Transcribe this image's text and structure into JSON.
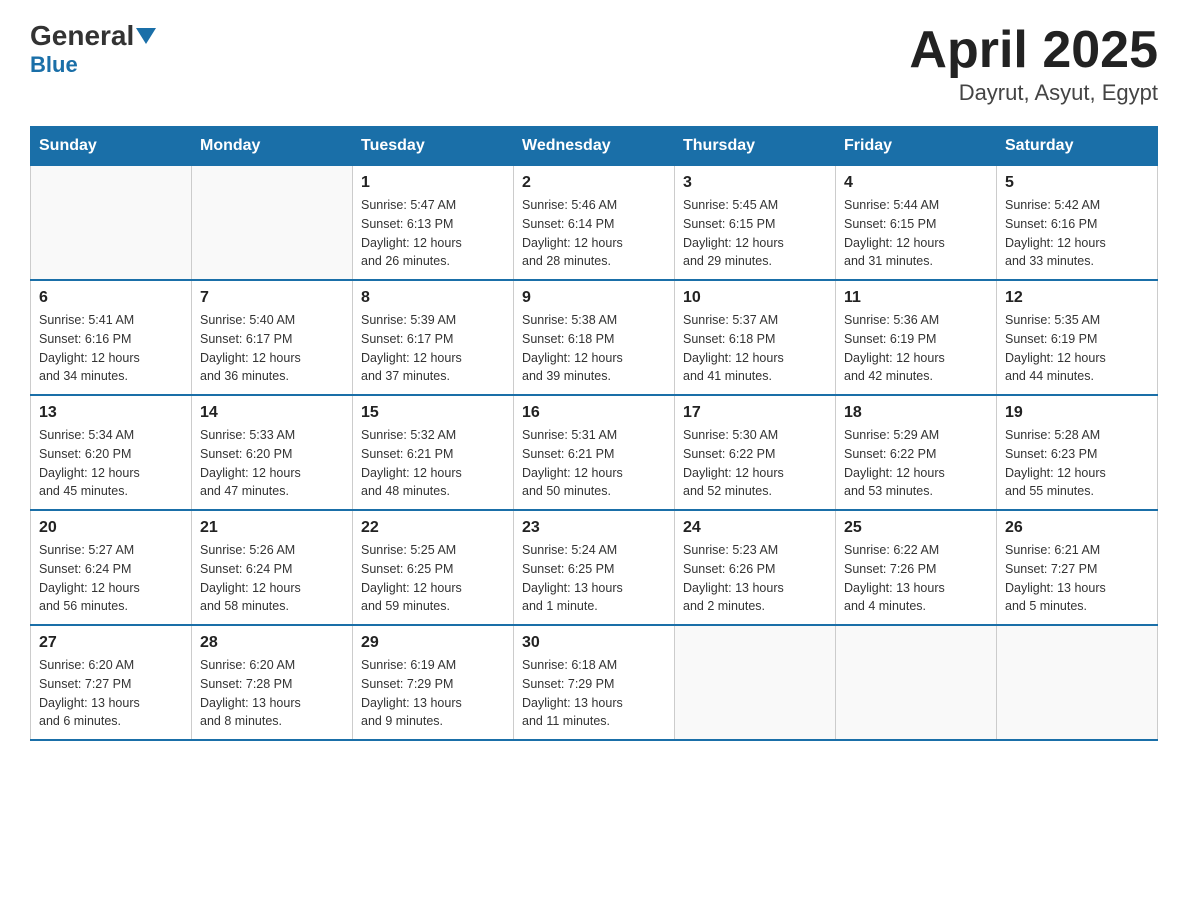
{
  "header": {
    "logo_main": "General",
    "logo_sub": "Blue",
    "title": "April 2025",
    "subtitle": "Dayrut, Asyut, Egypt"
  },
  "days_of_week": [
    "Sunday",
    "Monday",
    "Tuesday",
    "Wednesday",
    "Thursday",
    "Friday",
    "Saturday"
  ],
  "weeks": [
    [
      {
        "day": "",
        "info": ""
      },
      {
        "day": "",
        "info": ""
      },
      {
        "day": "1",
        "info": "Sunrise: 5:47 AM\nSunset: 6:13 PM\nDaylight: 12 hours\nand 26 minutes."
      },
      {
        "day": "2",
        "info": "Sunrise: 5:46 AM\nSunset: 6:14 PM\nDaylight: 12 hours\nand 28 minutes."
      },
      {
        "day": "3",
        "info": "Sunrise: 5:45 AM\nSunset: 6:15 PM\nDaylight: 12 hours\nand 29 minutes."
      },
      {
        "day": "4",
        "info": "Sunrise: 5:44 AM\nSunset: 6:15 PM\nDaylight: 12 hours\nand 31 minutes."
      },
      {
        "day": "5",
        "info": "Sunrise: 5:42 AM\nSunset: 6:16 PM\nDaylight: 12 hours\nand 33 minutes."
      }
    ],
    [
      {
        "day": "6",
        "info": "Sunrise: 5:41 AM\nSunset: 6:16 PM\nDaylight: 12 hours\nand 34 minutes."
      },
      {
        "day": "7",
        "info": "Sunrise: 5:40 AM\nSunset: 6:17 PM\nDaylight: 12 hours\nand 36 minutes."
      },
      {
        "day": "8",
        "info": "Sunrise: 5:39 AM\nSunset: 6:17 PM\nDaylight: 12 hours\nand 37 minutes."
      },
      {
        "day": "9",
        "info": "Sunrise: 5:38 AM\nSunset: 6:18 PM\nDaylight: 12 hours\nand 39 minutes."
      },
      {
        "day": "10",
        "info": "Sunrise: 5:37 AM\nSunset: 6:18 PM\nDaylight: 12 hours\nand 41 minutes."
      },
      {
        "day": "11",
        "info": "Sunrise: 5:36 AM\nSunset: 6:19 PM\nDaylight: 12 hours\nand 42 minutes."
      },
      {
        "day": "12",
        "info": "Sunrise: 5:35 AM\nSunset: 6:19 PM\nDaylight: 12 hours\nand 44 minutes."
      }
    ],
    [
      {
        "day": "13",
        "info": "Sunrise: 5:34 AM\nSunset: 6:20 PM\nDaylight: 12 hours\nand 45 minutes."
      },
      {
        "day": "14",
        "info": "Sunrise: 5:33 AM\nSunset: 6:20 PM\nDaylight: 12 hours\nand 47 minutes."
      },
      {
        "day": "15",
        "info": "Sunrise: 5:32 AM\nSunset: 6:21 PM\nDaylight: 12 hours\nand 48 minutes."
      },
      {
        "day": "16",
        "info": "Sunrise: 5:31 AM\nSunset: 6:21 PM\nDaylight: 12 hours\nand 50 minutes."
      },
      {
        "day": "17",
        "info": "Sunrise: 5:30 AM\nSunset: 6:22 PM\nDaylight: 12 hours\nand 52 minutes."
      },
      {
        "day": "18",
        "info": "Sunrise: 5:29 AM\nSunset: 6:22 PM\nDaylight: 12 hours\nand 53 minutes."
      },
      {
        "day": "19",
        "info": "Sunrise: 5:28 AM\nSunset: 6:23 PM\nDaylight: 12 hours\nand 55 minutes."
      }
    ],
    [
      {
        "day": "20",
        "info": "Sunrise: 5:27 AM\nSunset: 6:24 PM\nDaylight: 12 hours\nand 56 minutes."
      },
      {
        "day": "21",
        "info": "Sunrise: 5:26 AM\nSunset: 6:24 PM\nDaylight: 12 hours\nand 58 minutes."
      },
      {
        "day": "22",
        "info": "Sunrise: 5:25 AM\nSunset: 6:25 PM\nDaylight: 12 hours\nand 59 minutes."
      },
      {
        "day": "23",
        "info": "Sunrise: 5:24 AM\nSunset: 6:25 PM\nDaylight: 13 hours\nand 1 minute."
      },
      {
        "day": "24",
        "info": "Sunrise: 5:23 AM\nSunset: 6:26 PM\nDaylight: 13 hours\nand 2 minutes."
      },
      {
        "day": "25",
        "info": "Sunrise: 6:22 AM\nSunset: 7:26 PM\nDaylight: 13 hours\nand 4 minutes."
      },
      {
        "day": "26",
        "info": "Sunrise: 6:21 AM\nSunset: 7:27 PM\nDaylight: 13 hours\nand 5 minutes."
      }
    ],
    [
      {
        "day": "27",
        "info": "Sunrise: 6:20 AM\nSunset: 7:27 PM\nDaylight: 13 hours\nand 6 minutes."
      },
      {
        "day": "28",
        "info": "Sunrise: 6:20 AM\nSunset: 7:28 PM\nDaylight: 13 hours\nand 8 minutes."
      },
      {
        "day": "29",
        "info": "Sunrise: 6:19 AM\nSunset: 7:29 PM\nDaylight: 13 hours\nand 9 minutes."
      },
      {
        "day": "30",
        "info": "Sunrise: 6:18 AM\nSunset: 7:29 PM\nDaylight: 13 hours\nand 11 minutes."
      },
      {
        "day": "",
        "info": ""
      },
      {
        "day": "",
        "info": ""
      },
      {
        "day": "",
        "info": ""
      }
    ]
  ]
}
